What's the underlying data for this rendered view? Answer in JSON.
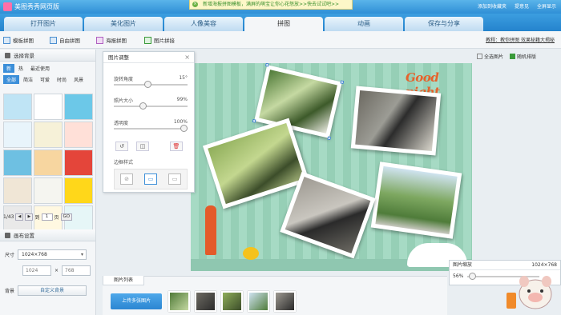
{
  "app": {
    "title": "美图秀秀网页版"
  },
  "notice": {
    "text": "新增海报拼图模板，满屏的萌宝让你心花怒放>>快去试试吧>>",
    "close": "×"
  },
  "toplinks": [
    "添加到收藏夹",
    "提意见",
    "全屏显示"
  ],
  "tabs": [
    "打开图片",
    "美化图片",
    "人像美容",
    "拼图",
    "动画",
    "保存与分享"
  ],
  "subbar": {
    "items": [
      "模板拼图",
      "自由拼图",
      "海报拼图",
      "图片拼接"
    ],
    "link": "教程：教你拼图 效果秘籍大揭秘"
  },
  "left": {
    "bg_title": "选择背景",
    "filters1": [
      "新",
      "热",
      "最近使用"
    ],
    "filters2": [
      "全部",
      "简洁",
      "可爱",
      "时尚",
      "风景"
    ],
    "thumb_colors": [
      "#bfe4f5",
      "#ffffff",
      "#6cc8e8",
      "#e8f4fb",
      "#f6f1d8",
      "#ffe0d8",
      "#6ec0e2",
      "#f7d6a0",
      "#e4453a",
      "#f0e6d6",
      "#f5f5f0",
      "#ffd71a",
      "#e9e9e9",
      "#fff8e1",
      "#e6f6f7"
    ],
    "pager": {
      "page_text": "1/43",
      "to": "到",
      "page": "1",
      "unit": "页",
      "go": "GO"
    },
    "canvas_title": "画布设置",
    "size_label": "尺寸",
    "size_value": "1024×768",
    "w": "1024",
    "times": "×",
    "h": "768",
    "bg_label": "背景",
    "custom_bg": "自定义背景"
  },
  "panel": {
    "title": "图片调整",
    "close": "×",
    "rotate_label": "旋转角度",
    "rotate_value": "15°",
    "scale_label": "照片大小",
    "scale_value": "99%",
    "opacity_label": "透明度",
    "opacity_value": "100%",
    "btns": [
      "↺",
      "◫",
      "🗑"
    ],
    "border_label": "边框样式"
  },
  "rtools": {
    "select_all": "全选图片",
    "random": "随机排版"
  },
  "canvas": {
    "text": "Good night"
  },
  "zoom": {
    "title": "图片缩放",
    "size": "1024×768",
    "percent": "56%"
  },
  "list": {
    "tab": "图片列表",
    "upload": "上传多张图片"
  }
}
